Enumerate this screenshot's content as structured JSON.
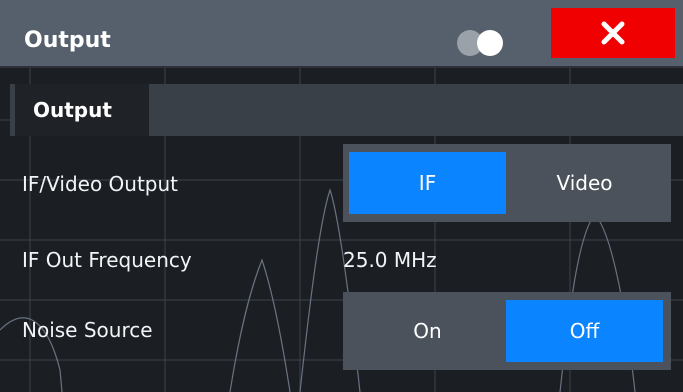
{
  "dialog": {
    "title": "Output",
    "close_label": "✕"
  },
  "tabs": [
    {
      "label": "Output",
      "active": true
    }
  ],
  "settings": {
    "if_video_output": {
      "label": "IF/Video Output",
      "options": [
        "IF",
        "Video"
      ],
      "selected": "IF"
    },
    "if_out_frequency": {
      "label": "IF Out Frequency",
      "value": "25.0 MHz"
    },
    "noise_source": {
      "label": "Noise Source",
      "options": [
        "On",
        "Off"
      ],
      "selected": "Off"
    }
  },
  "colors": {
    "accent": "#0a84ff",
    "close": "#f00000",
    "titlebar": "#55606c",
    "background": "#1b1f24"
  },
  "icons": {
    "toggle": "display-toggle-icon",
    "close": "close-icon"
  }
}
